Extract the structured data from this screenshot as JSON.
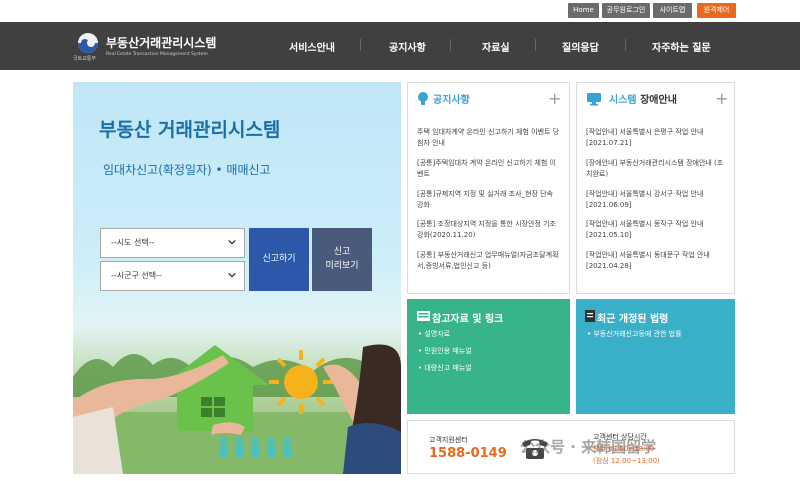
{
  "util": {
    "home": "Home",
    "login": "공무원로그인",
    "sitemap": "사이트맵",
    "access": "원격제어"
  },
  "header": {
    "title": "부동산거래관리시스템",
    "subtitle": "Real Estate Transaction Management System",
    "org": "국토교통부",
    "nav": [
      "서비스안내",
      "공지사항",
      "자료실",
      "질의응답",
      "자주하는 질문"
    ]
  },
  "hero": {
    "title": "부동산 거래관리시스템",
    "subtitle": "임대차신고(확정일자) • 매매신고",
    "select_sido": "--시도 선택--",
    "select_sigungu": "--시군구 선택--",
    "report_btn": "신고하기",
    "preview_btn_1": "신고",
    "preview_btn_2": "미리보기"
  },
  "notices": {
    "title": "공지사항",
    "items": [
      "주택 임대차계약 온라인 신고하기 체험 이벤트 당첨자 안내",
      "[공통]주택임대차 계약 온라인 신고하기 체험 이벤트",
      "[공통]규제지역 지정 및 실거래 조사_현장 단속 강화",
      "[공통] 조정대상지역 지정을 통한 시장안정 기조 강화(2020.11.20)",
      "[공통] 부동산거래신고 업무매뉴얼(자금조달계획서,증빙서류,법인신고 등)"
    ]
  },
  "outage": {
    "title_hl": "시스템",
    "title_rest": " 장애안내",
    "items": [
      "[작업안내] 서울특별시 은평구 작업 안내 [2021.07.21]",
      "[장애안내] 부동산거래관리시스템 장애안내 (조치완료)",
      "[작업안내] 서울특별시 강서구 작업 안내 [2021.06.09]",
      "[작업안내] 서울특별시 동작구 작업 안내 [2021.05.10]",
      "[작업안내] 서울특별시 동대문구 작업 안내 [2021.04.28]"
    ]
  },
  "refs": {
    "title": "참고자료 및 링크",
    "items": [
      "설명자료",
      "민원인용 매뉴얼",
      "대량신고 매뉴얼"
    ]
  },
  "laws": {
    "title": "최근 개정된 법령",
    "items": [
      "부동산거래신고등에 관한 법률"
    ]
  },
  "center": {
    "label": "고객지원센터",
    "phone": "1588-0149",
    "hours_title": "고객센터 상담시간",
    "hours": "평일 09:00~18:00",
    "lunch": "(점심 12:00~13:00)"
  },
  "watermark": "公众号 · 来韩国留学",
  "colors": {
    "header_bg": "#404040",
    "hero_blue": "#1b6ea8",
    "teal": "#37b48a",
    "cyan": "#3ab0c8",
    "orange": "#e8681e"
  }
}
